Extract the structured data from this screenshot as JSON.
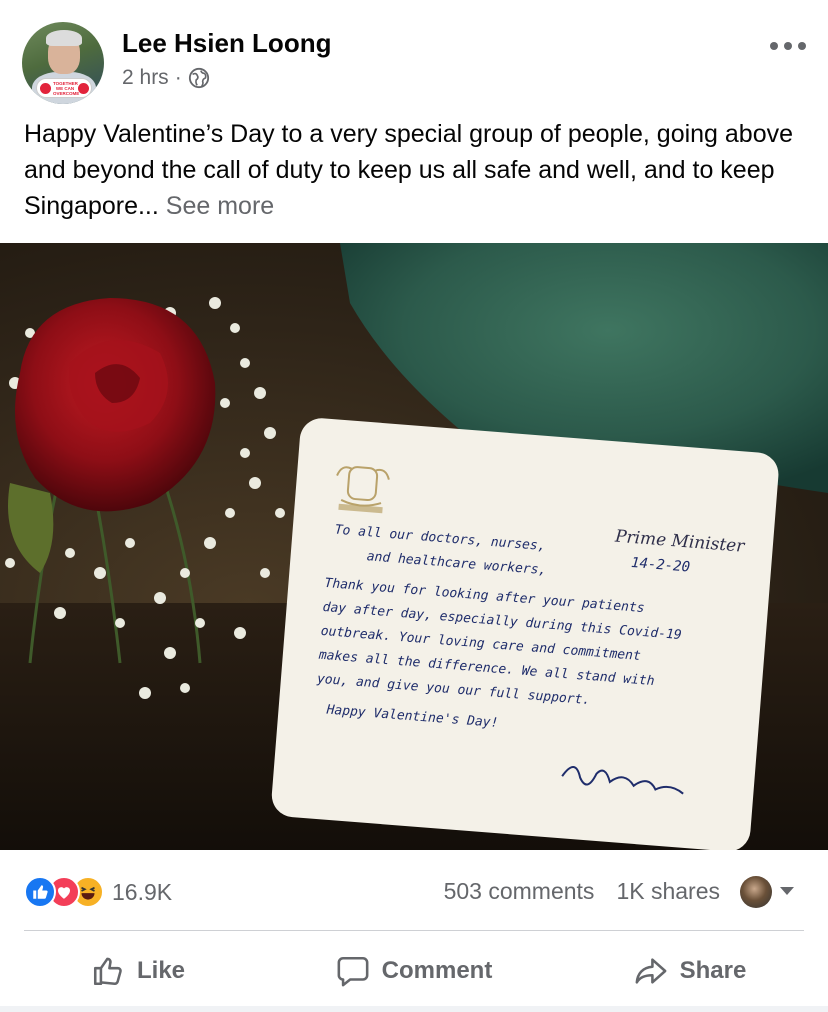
{
  "post": {
    "author": "Lee Hsien Loong",
    "time": "2 hrs",
    "separator": "·",
    "text": "Happy Valentine’s Day to a very special group of people, going above and beyond the call of duty to keep us all safe and well, and to keep Singapore...",
    "see_more": "See more",
    "avatar_badge": "TOGETHER WE CAN OVERCOME",
    "icons": {
      "privacy": "globe-icon",
      "menu": "more-icon"
    }
  },
  "card": {
    "heading": "Prime Minister",
    "date": "14-2-20",
    "lines": [
      "To all our doctors, nurses,",
      "and healthcare workers,",
      "Thank you for looking after your patients",
      "day after day, especially during this Covid-19",
      "outbreak. Your loving care and commitment",
      "makes all the difference. We all stand with",
      "you, and give you our full support.",
      "Happy Valentine's Day!"
    ],
    "signature": "LeeHsienLoong"
  },
  "stats": {
    "reaction_count": "16.9K",
    "comments": "503 comments",
    "shares": "1K shares",
    "reactions": [
      "like-icon",
      "love-icon",
      "haha-icon"
    ]
  },
  "actions": {
    "like": "Like",
    "comment": "Comment",
    "share": "Share"
  },
  "colors": {
    "text": "#050505",
    "secondary": "#65676b",
    "like_blue": "#1877f2",
    "love_red": "#f33e58",
    "haha_yellow": "#f7b125",
    "ink_blue": "#1f2d6b"
  }
}
